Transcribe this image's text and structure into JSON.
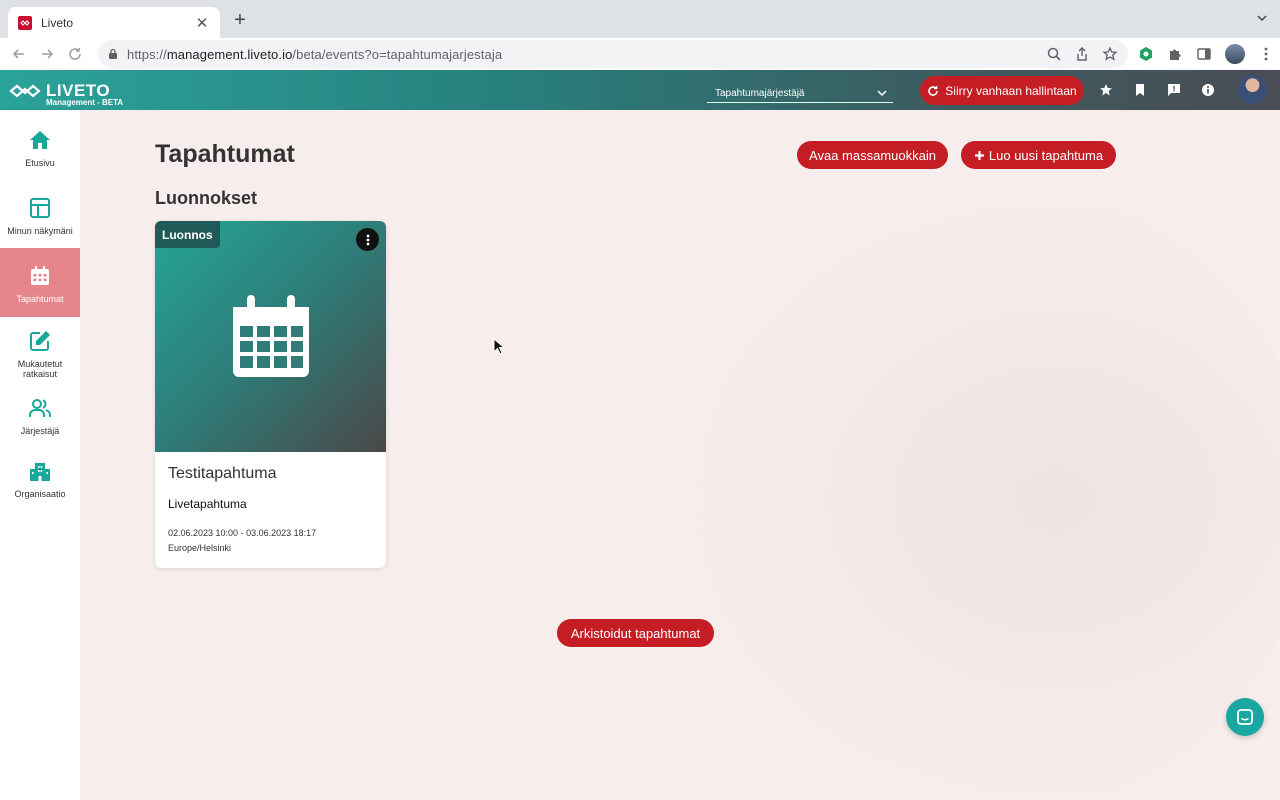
{
  "browser": {
    "tab_title": "Liveto",
    "url_prefix": "https://",
    "url_host": "management.liveto.io",
    "url_path": "/beta/events?o=tapahtumajarjestaja"
  },
  "header": {
    "logo_text": "LIVETO",
    "logo_sub": "Management - BETA",
    "role_selected": "Tapahtumajärjestäjä",
    "old_admin_label": "Siirry vanhaan hallintaan"
  },
  "sidebar": {
    "items": [
      {
        "label": "Etusivu",
        "icon": "home-icon"
      },
      {
        "label": "Minun näkymäni",
        "icon": "layout-icon"
      },
      {
        "label": "Tapahtumat",
        "icon": "calendar-icon"
      },
      {
        "label": "Mukautetut ratkaisut",
        "icon": "edit-icon"
      },
      {
        "label": "Järjestäjä",
        "icon": "users-icon"
      },
      {
        "label": "Organisaatio",
        "icon": "building-icon"
      }
    ]
  },
  "main": {
    "title": "Tapahtumat",
    "mass_edit_label": "Avaa massamuokkain",
    "new_event_label": "Luo uusi tapahtuma",
    "drafts_title": "Luonnokset",
    "archive_label": "Arkistoidut tapahtumat",
    "card": {
      "badge": "Luonnos",
      "title": "Testitapahtuma",
      "type": "Livetapahtuma",
      "dates": "02.06.2023 10:00 - 03.06.2023 18:17",
      "timezone": "Europe/Helsinki"
    }
  },
  "colors": {
    "brand_teal": "#2aa39a",
    "brand_red": "#c41e24",
    "active_nav": "#e6868a",
    "chat": "#1aa7a2"
  }
}
